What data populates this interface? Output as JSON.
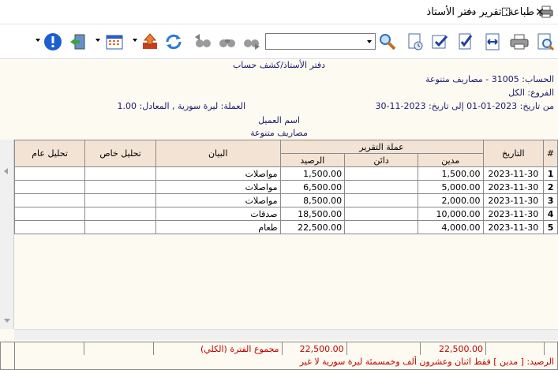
{
  "window": {
    "title": "طباعة: تقرير دفتر الأستاذ",
    "minimize": "—",
    "maximize": "☐",
    "close": "✕"
  },
  "toolbar": {
    "search_value": "",
    "icons": [
      "help-icon",
      "exit-icon",
      "calendar-icon",
      "upload-icon",
      "refresh-icon",
      "back-icon",
      "binoculars-icon",
      "forward-icon",
      "search-icon",
      "document-settings-icon",
      "check-document-icon",
      "edit-check-icon",
      "fit-width-icon",
      "print-icon",
      "print-preview-icon"
    ]
  },
  "report": {
    "title": "دفتر الأستاذ/كشف حساب",
    "account": "الحساب: 31005 - مصاريف متنوعة",
    "branch": "الفروع: الكل",
    "date_range": "من تاريخ: 2023-01-01  إلى تاريخ: 2023-11-30",
    "currency": "العملة: ليرة سورية , المعادل: 1.00",
    "customer_label": "اسم العميل",
    "customer_value": "مصاريف متنوعة"
  },
  "table": {
    "headers": {
      "index": "#",
      "date": "التاريخ",
      "currency_group": "عملة التقرير",
      "debit": "مدين",
      "credit": "دائن",
      "balance": "الرصيد",
      "statement": "البيان",
      "special_analysis": "تحليل خاص",
      "general_analysis": "تحليل عام"
    },
    "rows": [
      {
        "index": "1",
        "date": "2023-11-30",
        "debit": "1,500.00",
        "credit": "",
        "balance": "1,500.00",
        "statement": "مواصلات",
        "special": "",
        "general": ""
      },
      {
        "index": "2",
        "date": "2023-11-30",
        "debit": "5,000.00",
        "credit": "",
        "balance": "6,500.00",
        "statement": "مواصلات",
        "special": "",
        "general": ""
      },
      {
        "index": "3",
        "date": "2023-11-30",
        "debit": "2,000.00",
        "credit": "",
        "balance": "8,500.00",
        "statement": "مواصلات",
        "special": "",
        "general": ""
      },
      {
        "index": "4",
        "date": "2023-11-30",
        "debit": "10,000.00",
        "credit": "",
        "balance": "18,500.00",
        "statement": "صدقات",
        "special": "",
        "general": ""
      },
      {
        "index": "5",
        "date": "2023-11-30",
        "debit": "4,000.00",
        "credit": "",
        "balance": "22,500.00",
        "statement": "طعام",
        "special": "",
        "general": ""
      }
    ]
  },
  "footer": {
    "total_debit": "22,500.00",
    "total_balance": "22,500.00",
    "total_label": "مجموع الفترة (الكلي)",
    "balance_text": "الرصيد: [ مدين ] فقط اثنان وعشرون ألف وخمسمئة ليرة سورية لا غير"
  }
}
